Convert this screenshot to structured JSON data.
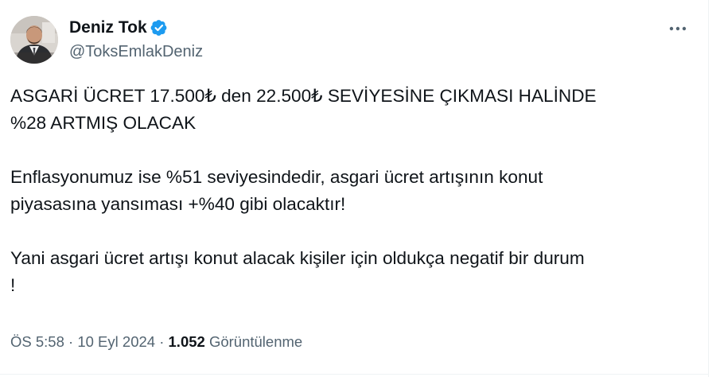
{
  "author": {
    "display_name": "Deniz Tok",
    "handle": "@ToksEmlakDeniz",
    "verified": true,
    "verified_color": "#1d9bf0"
  },
  "tweet": {
    "lines": [
      "ASGARİ ÜCRET 17.500₺ den 22.500₺ SEVİYESİNE ÇIKMASI HALİNDE",
      "%28 ARTMIŞ OLACAK",
      "",
      "Enflasyonumuz ise %51 seviyesindedir, asgari ücret artışının konut",
      "piyasasına yansıması +%40 gibi olacaktır!",
      "",
      "Yani asgari ücret artışı konut alacak kişiler için oldukça negatif bir durum",
      "!"
    ]
  },
  "meta": {
    "time": "ÖS 5:58",
    "separator": " · ",
    "date": "10 Eyl 2024",
    "views_count": "1.052",
    "views_label": "Görüntülenme"
  },
  "icons": {
    "verified": "verified-badge-icon",
    "more": "more-options-icon"
  },
  "colors": {
    "text": "#0f1419",
    "secondary": "#536471",
    "accent": "#1d9bf0",
    "border": "#eff3f4"
  }
}
